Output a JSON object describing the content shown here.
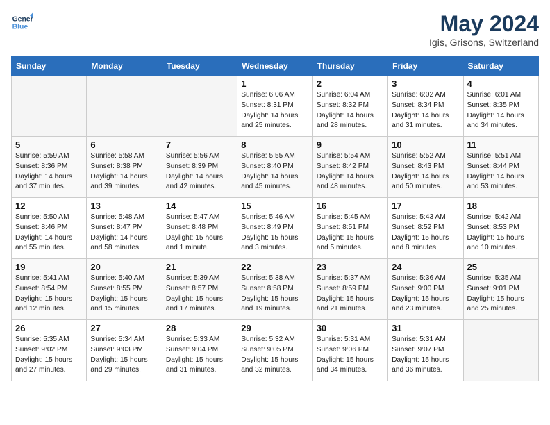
{
  "header": {
    "logo_line1": "General",
    "logo_line2": "Blue",
    "month": "May 2024",
    "location": "Igis, Grisons, Switzerland"
  },
  "days_of_week": [
    "Sunday",
    "Monday",
    "Tuesday",
    "Wednesday",
    "Thursday",
    "Friday",
    "Saturday"
  ],
  "weeks": [
    [
      {
        "day": "",
        "empty": true
      },
      {
        "day": "",
        "empty": true
      },
      {
        "day": "",
        "empty": true
      },
      {
        "day": "1",
        "sunrise": "Sunrise: 6:06 AM",
        "sunset": "Sunset: 8:31 PM",
        "daylight": "Daylight: 14 hours and 25 minutes."
      },
      {
        "day": "2",
        "sunrise": "Sunrise: 6:04 AM",
        "sunset": "Sunset: 8:32 PM",
        "daylight": "Daylight: 14 hours and 28 minutes."
      },
      {
        "day": "3",
        "sunrise": "Sunrise: 6:02 AM",
        "sunset": "Sunset: 8:34 PM",
        "daylight": "Daylight: 14 hours and 31 minutes."
      },
      {
        "day": "4",
        "sunrise": "Sunrise: 6:01 AM",
        "sunset": "Sunset: 8:35 PM",
        "daylight": "Daylight: 14 hours and 34 minutes."
      }
    ],
    [
      {
        "day": "5",
        "sunrise": "Sunrise: 5:59 AM",
        "sunset": "Sunset: 8:36 PM",
        "daylight": "Daylight: 14 hours and 37 minutes."
      },
      {
        "day": "6",
        "sunrise": "Sunrise: 5:58 AM",
        "sunset": "Sunset: 8:38 PM",
        "daylight": "Daylight: 14 hours and 39 minutes."
      },
      {
        "day": "7",
        "sunrise": "Sunrise: 5:56 AM",
        "sunset": "Sunset: 8:39 PM",
        "daylight": "Daylight: 14 hours and 42 minutes."
      },
      {
        "day": "8",
        "sunrise": "Sunrise: 5:55 AM",
        "sunset": "Sunset: 8:40 PM",
        "daylight": "Daylight: 14 hours and 45 minutes."
      },
      {
        "day": "9",
        "sunrise": "Sunrise: 5:54 AM",
        "sunset": "Sunset: 8:42 PM",
        "daylight": "Daylight: 14 hours and 48 minutes."
      },
      {
        "day": "10",
        "sunrise": "Sunrise: 5:52 AM",
        "sunset": "Sunset: 8:43 PM",
        "daylight": "Daylight: 14 hours and 50 minutes."
      },
      {
        "day": "11",
        "sunrise": "Sunrise: 5:51 AM",
        "sunset": "Sunset: 8:44 PM",
        "daylight": "Daylight: 14 hours and 53 minutes."
      }
    ],
    [
      {
        "day": "12",
        "sunrise": "Sunrise: 5:50 AM",
        "sunset": "Sunset: 8:46 PM",
        "daylight": "Daylight: 14 hours and 55 minutes."
      },
      {
        "day": "13",
        "sunrise": "Sunrise: 5:48 AM",
        "sunset": "Sunset: 8:47 PM",
        "daylight": "Daylight: 14 hours and 58 minutes."
      },
      {
        "day": "14",
        "sunrise": "Sunrise: 5:47 AM",
        "sunset": "Sunset: 8:48 PM",
        "daylight": "Daylight: 15 hours and 1 minute."
      },
      {
        "day": "15",
        "sunrise": "Sunrise: 5:46 AM",
        "sunset": "Sunset: 8:49 PM",
        "daylight": "Daylight: 15 hours and 3 minutes."
      },
      {
        "day": "16",
        "sunrise": "Sunrise: 5:45 AM",
        "sunset": "Sunset: 8:51 PM",
        "daylight": "Daylight: 15 hours and 5 minutes."
      },
      {
        "day": "17",
        "sunrise": "Sunrise: 5:43 AM",
        "sunset": "Sunset: 8:52 PM",
        "daylight": "Daylight: 15 hours and 8 minutes."
      },
      {
        "day": "18",
        "sunrise": "Sunrise: 5:42 AM",
        "sunset": "Sunset: 8:53 PM",
        "daylight": "Daylight: 15 hours and 10 minutes."
      }
    ],
    [
      {
        "day": "19",
        "sunrise": "Sunrise: 5:41 AM",
        "sunset": "Sunset: 8:54 PM",
        "daylight": "Daylight: 15 hours and 12 minutes."
      },
      {
        "day": "20",
        "sunrise": "Sunrise: 5:40 AM",
        "sunset": "Sunset: 8:55 PM",
        "daylight": "Daylight: 15 hours and 15 minutes."
      },
      {
        "day": "21",
        "sunrise": "Sunrise: 5:39 AM",
        "sunset": "Sunset: 8:57 PM",
        "daylight": "Daylight: 15 hours and 17 minutes."
      },
      {
        "day": "22",
        "sunrise": "Sunrise: 5:38 AM",
        "sunset": "Sunset: 8:58 PM",
        "daylight": "Daylight: 15 hours and 19 minutes."
      },
      {
        "day": "23",
        "sunrise": "Sunrise: 5:37 AM",
        "sunset": "Sunset: 8:59 PM",
        "daylight": "Daylight: 15 hours and 21 minutes."
      },
      {
        "day": "24",
        "sunrise": "Sunrise: 5:36 AM",
        "sunset": "Sunset: 9:00 PM",
        "daylight": "Daylight: 15 hours and 23 minutes."
      },
      {
        "day": "25",
        "sunrise": "Sunrise: 5:35 AM",
        "sunset": "Sunset: 9:01 PM",
        "daylight": "Daylight: 15 hours and 25 minutes."
      }
    ],
    [
      {
        "day": "26",
        "sunrise": "Sunrise: 5:35 AM",
        "sunset": "Sunset: 9:02 PM",
        "daylight": "Daylight: 15 hours and 27 minutes."
      },
      {
        "day": "27",
        "sunrise": "Sunrise: 5:34 AM",
        "sunset": "Sunset: 9:03 PM",
        "daylight": "Daylight: 15 hours and 29 minutes."
      },
      {
        "day": "28",
        "sunrise": "Sunrise: 5:33 AM",
        "sunset": "Sunset: 9:04 PM",
        "daylight": "Daylight: 15 hours and 31 minutes."
      },
      {
        "day": "29",
        "sunrise": "Sunrise: 5:32 AM",
        "sunset": "Sunset: 9:05 PM",
        "daylight": "Daylight: 15 hours and 32 minutes."
      },
      {
        "day": "30",
        "sunrise": "Sunrise: 5:31 AM",
        "sunset": "Sunset: 9:06 PM",
        "daylight": "Daylight: 15 hours and 34 minutes."
      },
      {
        "day": "31",
        "sunrise": "Sunrise: 5:31 AM",
        "sunset": "Sunset: 9:07 PM",
        "daylight": "Daylight: 15 hours and 36 minutes."
      },
      {
        "day": "",
        "empty": true
      }
    ]
  ]
}
